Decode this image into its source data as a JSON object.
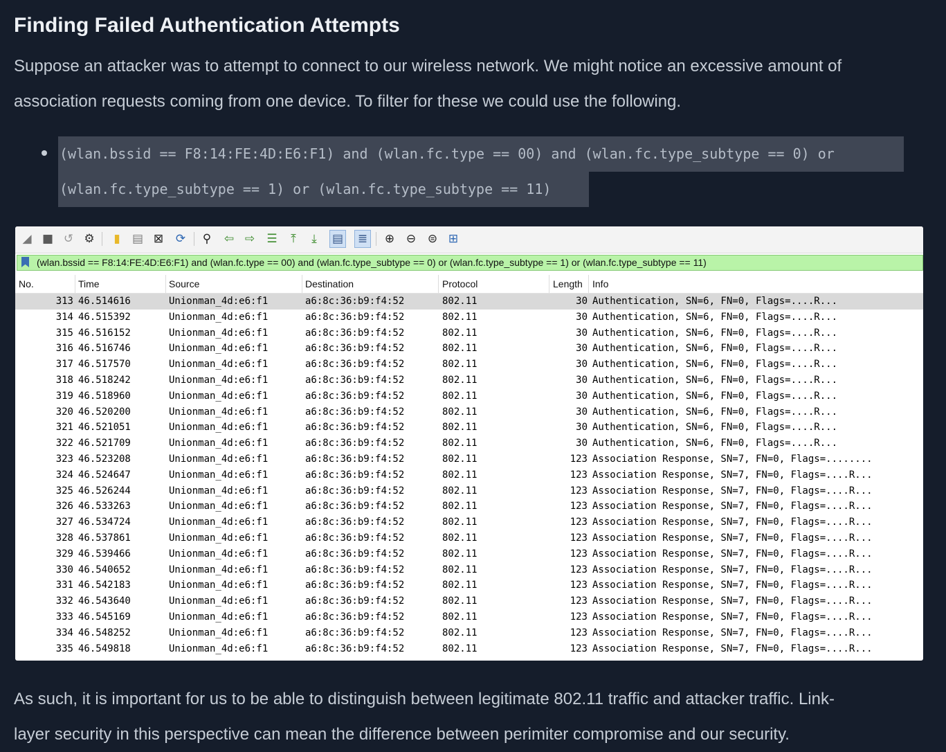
{
  "article": {
    "heading": "Finding Failed Authentication Attempts",
    "intro_line1": "Suppose an attacker was to attempt to connect to our wireless network. We might notice an excessive amount of",
    "intro_line2": "association requests coming from one device. To filter for these we could use the following.",
    "filter_code_line1": "(wlan.bssid == F8:14:FE:4D:E6:F1) and (wlan.fc.type == 00) and (wlan.fc.type_subtype == 0) or",
    "filter_code_line2": "(wlan.fc.type_subtype == 1) or (wlan.fc.type_subtype == 11)",
    "outro_line1": "As such, it is important for us to be able to distinguish between legitimate 802.11 traffic and attacker traffic. Link-",
    "outro_line2": "layer security in this perspective can mean the difference between perimiter compromise and our security."
  },
  "wireshark": {
    "toolbar_icons": [
      "shark-fin-icon",
      "stop-icon",
      "restart-icon",
      "options-gear-icon",
      "open-folder-icon",
      "save-file-icon",
      "close-file-icon",
      "reload-icon",
      "find-icon",
      "go-back-icon",
      "go-forward-icon",
      "go-to-packet-icon",
      "first-packet-icon",
      "last-packet-icon",
      "autoscroll-icon",
      "colorize-icon",
      "zoom-in-icon",
      "zoom-out-icon",
      "normal-size-icon",
      "resize-columns-icon"
    ],
    "display_filter": "(wlan.bssid == F8:14:FE:4D:E6:F1) and (wlan.fc.type == 00) and (wlan.fc.type_subtype == 0) or (wlan.fc.type_subtype == 1) or (wlan.fc.type_subtype == 11)",
    "filter_bg_color": "#b9f3a8",
    "columns": {
      "no": "No.",
      "time": "Time",
      "source": "Source",
      "destination": "Destination",
      "protocol": "Protocol",
      "length": "Length",
      "info": "Info"
    },
    "packets": [
      {
        "no": "313",
        "time": "46.514616",
        "src": "Unionman_4d:e6:f1",
        "dst": "a6:8c:36:b9:f4:52",
        "proto": "802.11",
        "len": "30",
        "info": "Authentication, SN=6, FN=0, Flags=....R..."
      },
      {
        "no": "314",
        "time": "46.515392",
        "src": "Unionman_4d:e6:f1",
        "dst": "a6:8c:36:b9:f4:52",
        "proto": "802.11",
        "len": "30",
        "info": "Authentication, SN=6, FN=0, Flags=....R..."
      },
      {
        "no": "315",
        "time": "46.516152",
        "src": "Unionman_4d:e6:f1",
        "dst": "a6:8c:36:b9:f4:52",
        "proto": "802.11",
        "len": "30",
        "info": "Authentication, SN=6, FN=0, Flags=....R..."
      },
      {
        "no": "316",
        "time": "46.516746",
        "src": "Unionman_4d:e6:f1",
        "dst": "a6:8c:36:b9:f4:52",
        "proto": "802.11",
        "len": "30",
        "info": "Authentication, SN=6, FN=0, Flags=....R..."
      },
      {
        "no": "317",
        "time": "46.517570",
        "src": "Unionman_4d:e6:f1",
        "dst": "a6:8c:36:b9:f4:52",
        "proto": "802.11",
        "len": "30",
        "info": "Authentication, SN=6, FN=0, Flags=....R..."
      },
      {
        "no": "318",
        "time": "46.518242",
        "src": "Unionman_4d:e6:f1",
        "dst": "a6:8c:36:b9:f4:52",
        "proto": "802.11",
        "len": "30",
        "info": "Authentication, SN=6, FN=0, Flags=....R..."
      },
      {
        "no": "319",
        "time": "46.518960",
        "src": "Unionman_4d:e6:f1",
        "dst": "a6:8c:36:b9:f4:52",
        "proto": "802.11",
        "len": "30",
        "info": "Authentication, SN=6, FN=0, Flags=....R..."
      },
      {
        "no": "320",
        "time": "46.520200",
        "src": "Unionman_4d:e6:f1",
        "dst": "a6:8c:36:b9:f4:52",
        "proto": "802.11",
        "len": "30",
        "info": "Authentication, SN=6, FN=0, Flags=....R..."
      },
      {
        "no": "321",
        "time": "46.521051",
        "src": "Unionman_4d:e6:f1",
        "dst": "a6:8c:36:b9:f4:52",
        "proto": "802.11",
        "len": "30",
        "info": "Authentication, SN=6, FN=0, Flags=....R..."
      },
      {
        "no": "322",
        "time": "46.521709",
        "src": "Unionman_4d:e6:f1",
        "dst": "a6:8c:36:b9:f4:52",
        "proto": "802.11",
        "len": "30",
        "info": "Authentication, SN=6, FN=0, Flags=....R..."
      },
      {
        "no": "323",
        "time": "46.523208",
        "src": "Unionman_4d:e6:f1",
        "dst": "a6:8c:36:b9:f4:52",
        "proto": "802.11",
        "len": "123",
        "info": "Association Response, SN=7, FN=0, Flags=........"
      },
      {
        "no": "324",
        "time": "46.524647",
        "src": "Unionman_4d:e6:f1",
        "dst": "a6:8c:36:b9:f4:52",
        "proto": "802.11",
        "len": "123",
        "info": "Association Response, SN=7, FN=0, Flags=....R..."
      },
      {
        "no": "325",
        "time": "46.526244",
        "src": "Unionman_4d:e6:f1",
        "dst": "a6:8c:36:b9:f4:52",
        "proto": "802.11",
        "len": "123",
        "info": "Association Response, SN=7, FN=0, Flags=....R..."
      },
      {
        "no": "326",
        "time": "46.533263",
        "src": "Unionman_4d:e6:f1",
        "dst": "a6:8c:36:b9:f4:52",
        "proto": "802.11",
        "len": "123",
        "info": "Association Response, SN=7, FN=0, Flags=....R..."
      },
      {
        "no": "327",
        "time": "46.534724",
        "src": "Unionman_4d:e6:f1",
        "dst": "a6:8c:36:b9:f4:52",
        "proto": "802.11",
        "len": "123",
        "info": "Association Response, SN=7, FN=0, Flags=....R..."
      },
      {
        "no": "328",
        "time": "46.537861",
        "src": "Unionman_4d:e6:f1",
        "dst": "a6:8c:36:b9:f4:52",
        "proto": "802.11",
        "len": "123",
        "info": "Association Response, SN=7, FN=0, Flags=....R..."
      },
      {
        "no": "329",
        "time": "46.539466",
        "src": "Unionman_4d:e6:f1",
        "dst": "a6:8c:36:b9:f4:52",
        "proto": "802.11",
        "len": "123",
        "info": "Association Response, SN=7, FN=0, Flags=....R..."
      },
      {
        "no": "330",
        "time": "46.540652",
        "src": "Unionman_4d:e6:f1",
        "dst": "a6:8c:36:b9:f4:52",
        "proto": "802.11",
        "len": "123",
        "info": "Association Response, SN=7, FN=0, Flags=....R..."
      },
      {
        "no": "331",
        "time": "46.542183",
        "src": "Unionman_4d:e6:f1",
        "dst": "a6:8c:36:b9:f4:52",
        "proto": "802.11",
        "len": "123",
        "info": "Association Response, SN=7, FN=0, Flags=....R..."
      },
      {
        "no": "332",
        "time": "46.543640",
        "src": "Unionman_4d:e6:f1",
        "dst": "a6:8c:36:b9:f4:52",
        "proto": "802.11",
        "len": "123",
        "info": "Association Response, SN=7, FN=0, Flags=....R..."
      },
      {
        "no": "333",
        "time": "46.545169",
        "src": "Unionman_4d:e6:f1",
        "dst": "a6:8c:36:b9:f4:52",
        "proto": "802.11",
        "len": "123",
        "info": "Association Response, SN=7, FN=0, Flags=....R..."
      },
      {
        "no": "334",
        "time": "46.548252",
        "src": "Unionman_4d:e6:f1",
        "dst": "a6:8c:36:b9:f4:52",
        "proto": "802.11",
        "len": "123",
        "info": "Association Response, SN=7, FN=0, Flags=....R..."
      },
      {
        "no": "335",
        "time": "46.549818",
        "src": "Unionman_4d:e6:f1",
        "dst": "a6:8c:36:b9:f4:52",
        "proto": "802.11",
        "len": "123",
        "info": "Association Response, SN=7, FN=0, Flags=....R..."
      }
    ]
  }
}
